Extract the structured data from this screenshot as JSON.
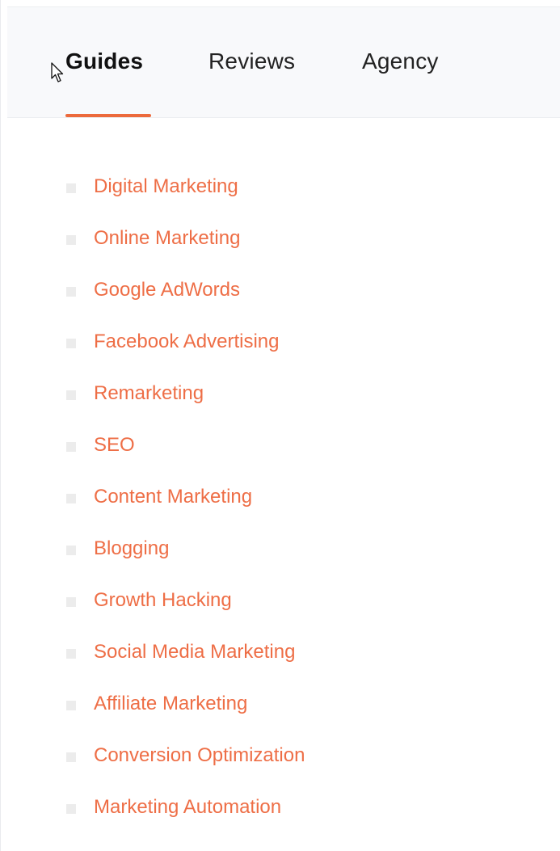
{
  "tabs": [
    {
      "label": "Guides",
      "active": true
    },
    {
      "label": "Reviews",
      "active": false
    },
    {
      "label": "Agency",
      "active": false
    }
  ],
  "colors": {
    "accent": "#ec6a3c",
    "link": "#ee6e46",
    "tab_bar_bg": "#f8f9fb",
    "bullet": "#ececec"
  },
  "guides": [
    {
      "label": "Digital Marketing"
    },
    {
      "label": "Online Marketing"
    },
    {
      "label": "Google AdWords"
    },
    {
      "label": "Facebook Advertising"
    },
    {
      "label": "Remarketing"
    },
    {
      "label": "SEO"
    },
    {
      "label": "Content Marketing"
    },
    {
      "label": "Blogging"
    },
    {
      "label": "Growth Hacking"
    },
    {
      "label": "Social Media Marketing"
    },
    {
      "label": "Affiliate Marketing"
    },
    {
      "label": "Conversion Optimization"
    },
    {
      "label": "Marketing Automation"
    }
  ]
}
